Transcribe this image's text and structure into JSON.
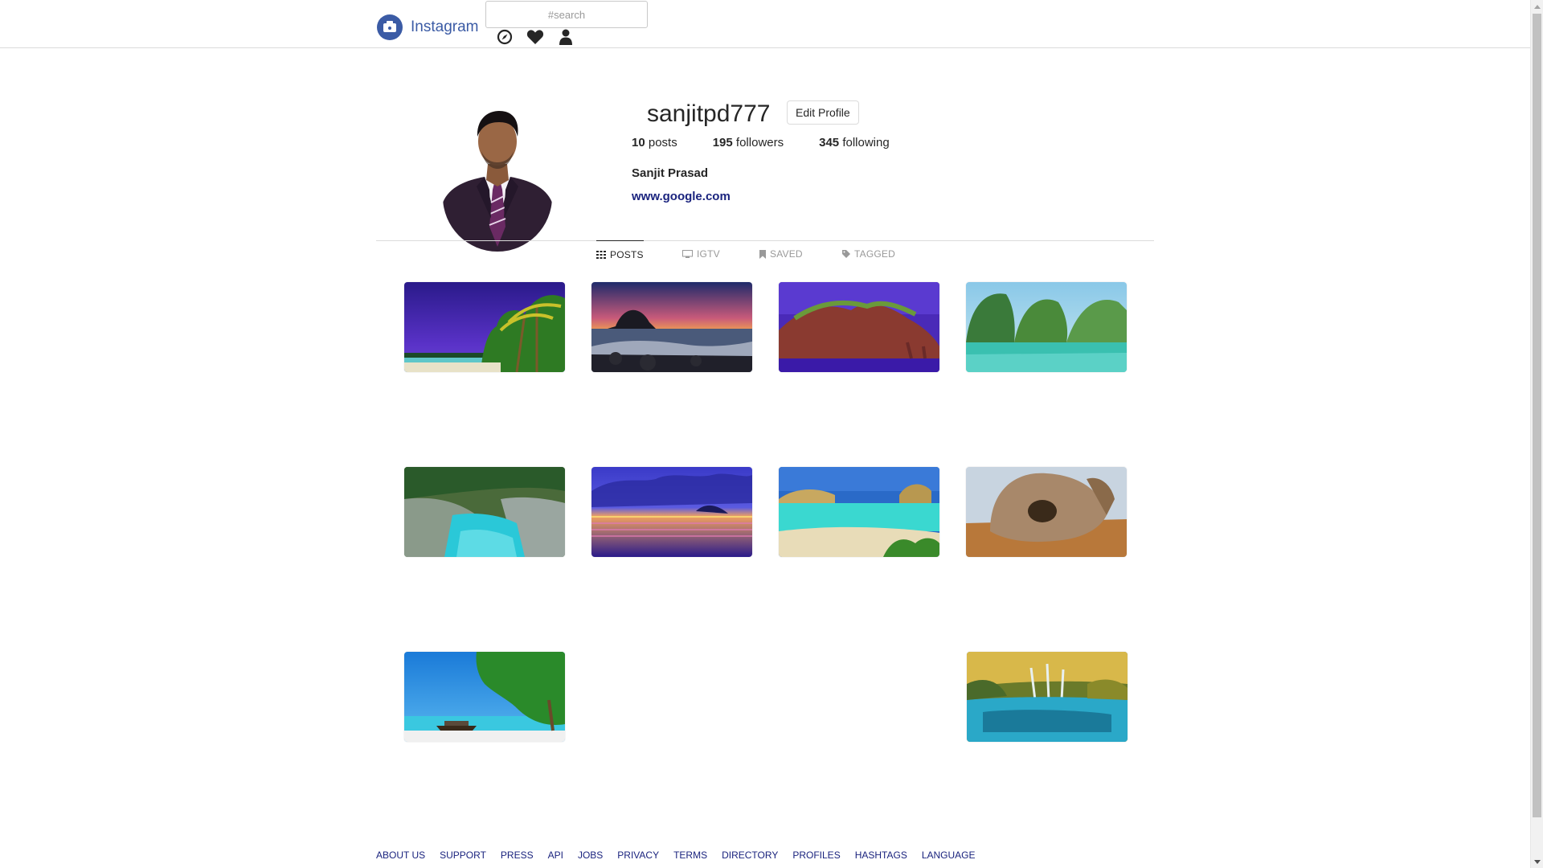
{
  "header": {
    "brand": "Instagram",
    "search_placeholder": "#search",
    "icons": [
      "compass-icon",
      "heart-icon",
      "user-icon"
    ]
  },
  "profile": {
    "username": "sanjitpd777",
    "edit_label": "Edit Profile",
    "stats": {
      "posts_count": "10",
      "posts_label": "posts",
      "followers_count": "195",
      "followers_label": "followers",
      "following_count": "345",
      "following_label": "following"
    },
    "full_name": "Sanjit Prasad",
    "website": "www.google.com"
  },
  "tabs": [
    {
      "label": "POSTS",
      "icon": "grid-icon",
      "active": true
    },
    {
      "label": "IGTV",
      "icon": "tv-icon",
      "active": false
    },
    {
      "label": "SAVED",
      "icon": "bookmark-icon",
      "active": false
    },
    {
      "label": "TAGGED",
      "icon": "tag-icon",
      "active": false
    }
  ],
  "posts": [
    "tropical-beach-palms",
    "rocky-shore-sunset",
    "purple-sea-cliffs",
    "green-lagoon-islands",
    "turquoise-rocky-cove",
    "purple-ocean-sunset",
    "beach-with-rocks",
    "sandstone-rock-formation",
    "boat-under-palm-tree",
    "forest-waterfall-lake"
  ],
  "footer": {
    "links": [
      "ABOUT US",
      "SUPPORT",
      "PRESS",
      "API",
      "JOBS",
      "PRIVACY",
      "TERMS",
      "DIRECTORY",
      "PROFILES",
      "HASHTAGS",
      "LANGUAGE"
    ]
  },
  "colors": {
    "brand": "#3b5ba5",
    "link": "#1a237e",
    "text": "#262626",
    "muted": "#999999",
    "border": "#dbdbdb"
  }
}
